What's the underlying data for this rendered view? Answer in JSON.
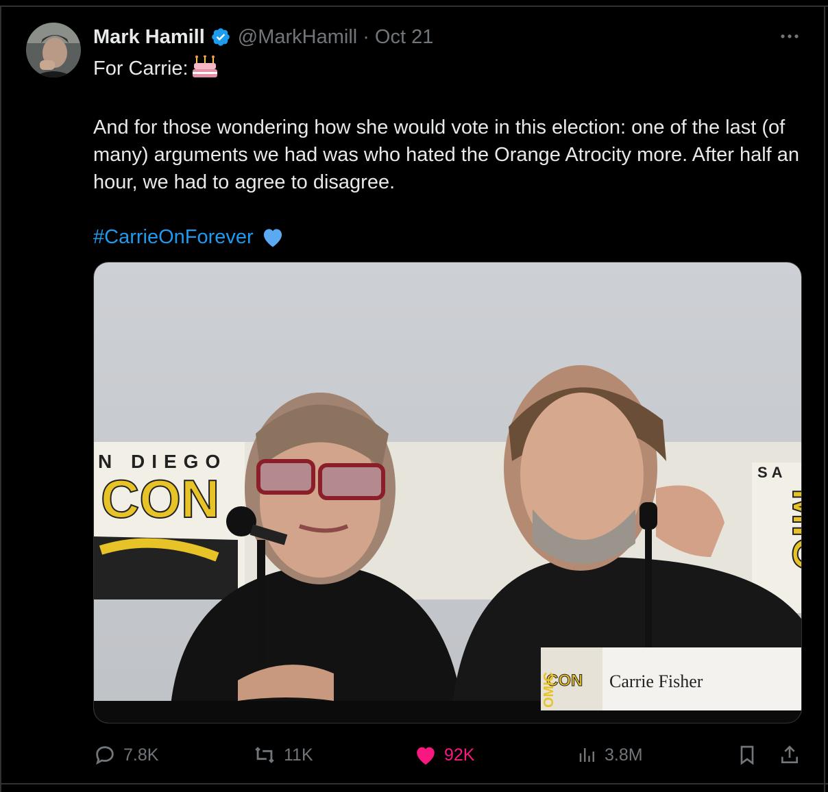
{
  "tweet": {
    "author": {
      "name": "Mark Hamill",
      "handle": "@MarkHamill",
      "separator": "·",
      "date": "Oct 21"
    },
    "text": {
      "line1": "For Carrie:",
      "line2": "And for those wondering how she would vote in this election: one of the last (of many) arguments we had was who hated the Orange Atrocity more. After half an hour, we had to agree to disagree.",
      "hashtag": "#CarrieOnForever"
    },
    "image": {
      "banner_text_1": "N  DIEGO",
      "banner_text_2": "CON",
      "banner_text_3": "SA",
      "banner_text_4": "MIC",
      "nameplate_logo": "CON",
      "nameplate_side": "OMIC",
      "nameplate": "Carrie Fisher"
    },
    "actions": {
      "replies": "7.8K",
      "reposts": "11K",
      "likes": "92K",
      "views": "3.8M"
    }
  },
  "colors": {
    "accent": "#1d9bf0",
    "like": "#f91880",
    "muted": "#71767b",
    "text": "#e7e9ea"
  },
  "icons": [
    "verified-badge-icon",
    "more-icon",
    "birthday-cake-emoji",
    "blue-heart-emoji",
    "reply-icon",
    "repost-icon",
    "like-icon",
    "views-icon",
    "bookmark-icon",
    "share-icon"
  ]
}
